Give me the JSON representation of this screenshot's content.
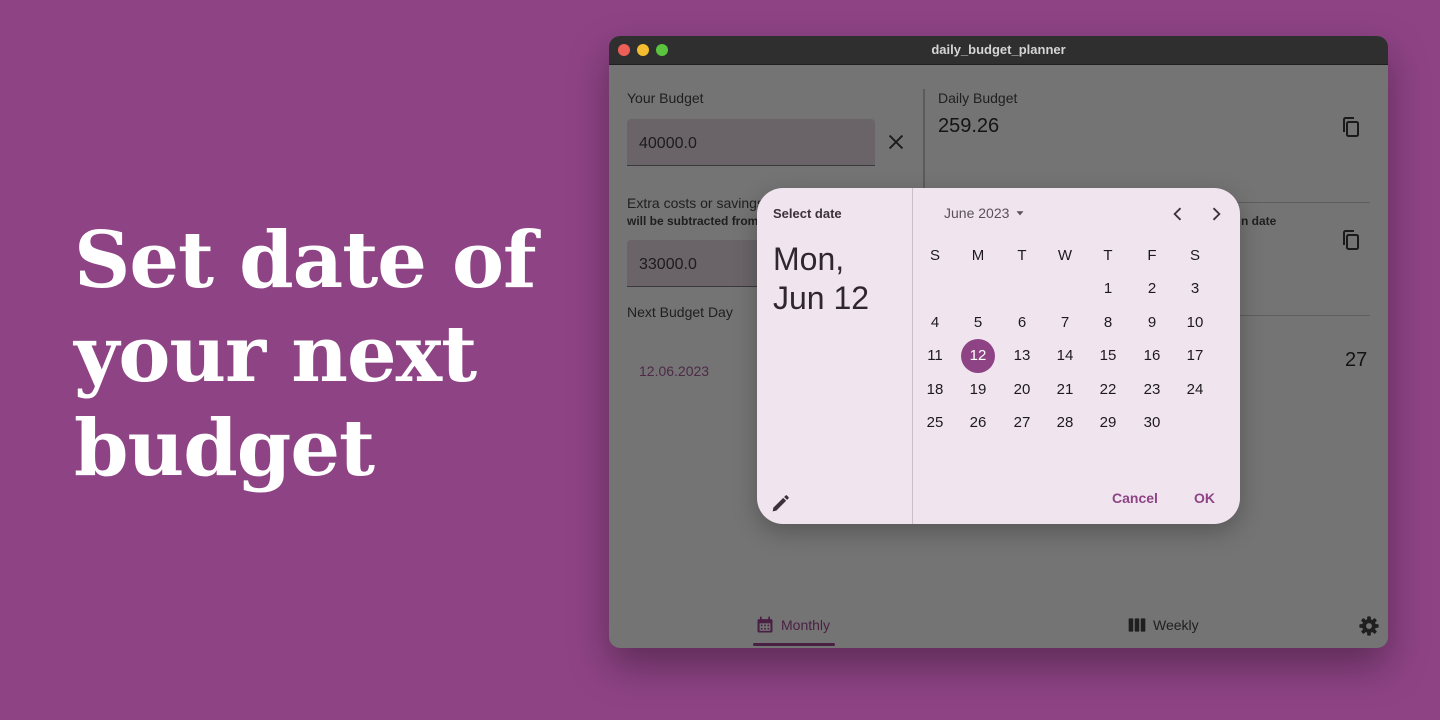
{
  "headline": [
    "Set date of",
    "your next",
    "budget"
  ],
  "window": {
    "title": "daily_budget_planner"
  },
  "left_panel": {
    "budget_label": "Your Budget",
    "budget_value": "40000.0",
    "extra_label": "Extra costs or savings",
    "extra_sublabel": "will be subtracted from",
    "extra_value": "33000.0",
    "next_day_label": "Next Budget Day",
    "next_day_value": "12.06.2023"
  },
  "right_panel": {
    "daily_label": "Daily Budget",
    "daily_value": "259.26",
    "second_sublabel_tail": "n date",
    "days_value": "27"
  },
  "nav": {
    "monthly": "Monthly",
    "weekly": "Weekly"
  },
  "date_picker": {
    "header": "Select date",
    "selected_line1": "Mon,",
    "selected_line2": "Jun 12",
    "month_label": "June 2023",
    "weekdays": [
      "S",
      "M",
      "T",
      "W",
      "T",
      "F",
      "S"
    ],
    "first_weekday_index": 4,
    "days_in_month": 30,
    "selected_day": 12,
    "cancel": "Cancel",
    "ok": "OK"
  },
  "colors": {
    "accent": "#8e4385",
    "page_bg": "#8e4385",
    "picker_bg": "#f0e5ef"
  }
}
